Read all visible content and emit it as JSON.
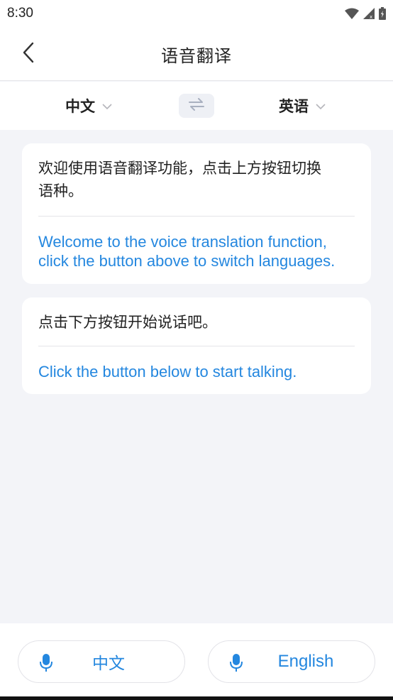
{
  "status_bar": {
    "time": "8:30",
    "icons": [
      "wifi-icon",
      "signal-icon",
      "battery-icon"
    ]
  },
  "header": {
    "title": "语音翻译",
    "back_icon": "chevron-left-icon"
  },
  "language_bar": {
    "source_language": "中文",
    "target_language": "英语",
    "swap_icon": "swap-arrows-icon",
    "dropdown_icon": "chevron-down-icon"
  },
  "messages": [
    {
      "source": "欢迎使用语音翻译功能，点击上方按钮切换语种。",
      "source_line1": "欢迎使用语音翻译功能，点击上方按钮切换",
      "source_line2": "语种。",
      "target_line1": "Welcome to the voice translation function,",
      "target_line2": "click the button above to switch languages."
    },
    {
      "source": "点击下方按钮开始说话吧。",
      "target": "Click the button below to start talking."
    }
  ],
  "bottom_bar": {
    "left_button_label": "中文",
    "right_button_label": "English",
    "mic_icon": "microphone-icon"
  },
  "colors": {
    "accent": "#2487df",
    "background": "#f3f4f8",
    "card": "#ffffff",
    "text": "#222222"
  }
}
